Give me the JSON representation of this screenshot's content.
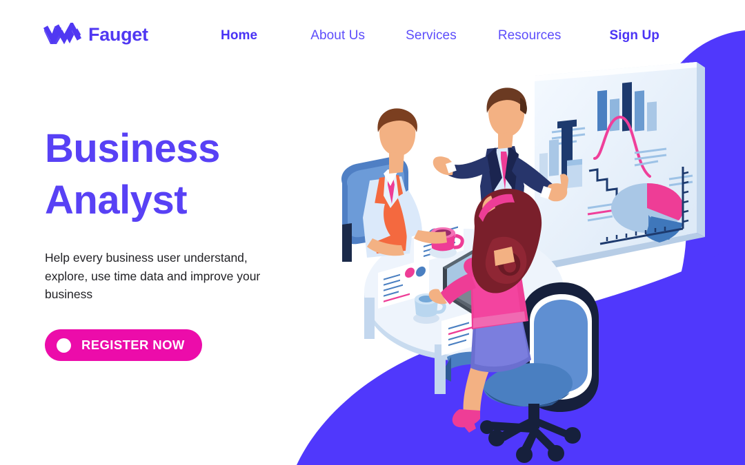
{
  "brand": {
    "name": "Fauget",
    "logo_icon": "zigzag-w-logo-icon",
    "color": "#5038f2"
  },
  "nav": {
    "items": [
      {
        "label": "Home",
        "active": true,
        "icon": "nav-link-icon"
      },
      {
        "label": "About Us",
        "active": false,
        "icon": "nav-link-icon"
      },
      {
        "label": "Services",
        "active": false,
        "icon": "nav-link-icon"
      },
      {
        "label": "Resources",
        "active": false,
        "icon": "nav-link-icon"
      },
      {
        "label": "Sign Up",
        "active": true,
        "icon": "nav-link-icon"
      }
    ],
    "link_color": "#5d4dfb",
    "active_color": "#4a33f5"
  },
  "hero": {
    "title_line1": "Business",
    "title_line2": "Analyst",
    "title_color": "#5841f5",
    "subtitle": "Help every business user understand, explore, use time data and improve your business",
    "subtitle_color": "#222226",
    "cta": {
      "label": "REGISTER NOW",
      "dot_icon": "circle-dot-icon",
      "background": "#ec0caa",
      "text_color": "#ffffff"
    }
  },
  "background": {
    "blob_color": "#5038fc",
    "page_color": "#ffffff",
    "shape": "purple-corner-blob-with-white-circle-cutout"
  },
  "illustration": {
    "name": "isometric-business-analytics-meeting",
    "scene_description": "Three people around a round white table reviewing analytics: a man standing presenting at a large chart board, a man seated in an orange vest pointing at reports, and a woman in a pink top working on a laptop in a blue office chair.",
    "elements": [
      {
        "name": "presentation-board",
        "icon": "dashboard-board-icon"
      },
      {
        "name": "bar-chart",
        "icon": "bar-chart-icon"
      },
      {
        "name": "bell-curve-line",
        "icon": "line-chart-icon"
      },
      {
        "name": "pie-chart",
        "icon": "pie-chart-icon"
      },
      {
        "name": "standing-presenter",
        "icon": "person-presenting-icon"
      },
      {
        "name": "seated-analyst",
        "icon": "person-seated-icon"
      },
      {
        "name": "laptop-worker",
        "icon": "person-laptop-icon"
      },
      {
        "name": "round-table",
        "icon": "table-icon"
      },
      {
        "name": "laptop",
        "icon": "laptop-icon"
      },
      {
        "name": "coffee-mug-pink",
        "icon": "mug-icon"
      },
      {
        "name": "coffee-mug-blue",
        "icon": "mug-icon"
      },
      {
        "name": "report-documents",
        "icon": "document-icon"
      },
      {
        "name": "office-chair",
        "icon": "office-chair-icon"
      }
    ],
    "palette": {
      "purple": "#5038fc",
      "pink": "#ec0caa",
      "magenta": "#ee3d96",
      "navy": "#1d2a5b",
      "steel_blue": "#4a7fc1",
      "light_blue": "#a9c7e6",
      "pale_blue": "#dce8f5",
      "skin": "#f3b183",
      "orange": "#f4693f"
    }
  }
}
